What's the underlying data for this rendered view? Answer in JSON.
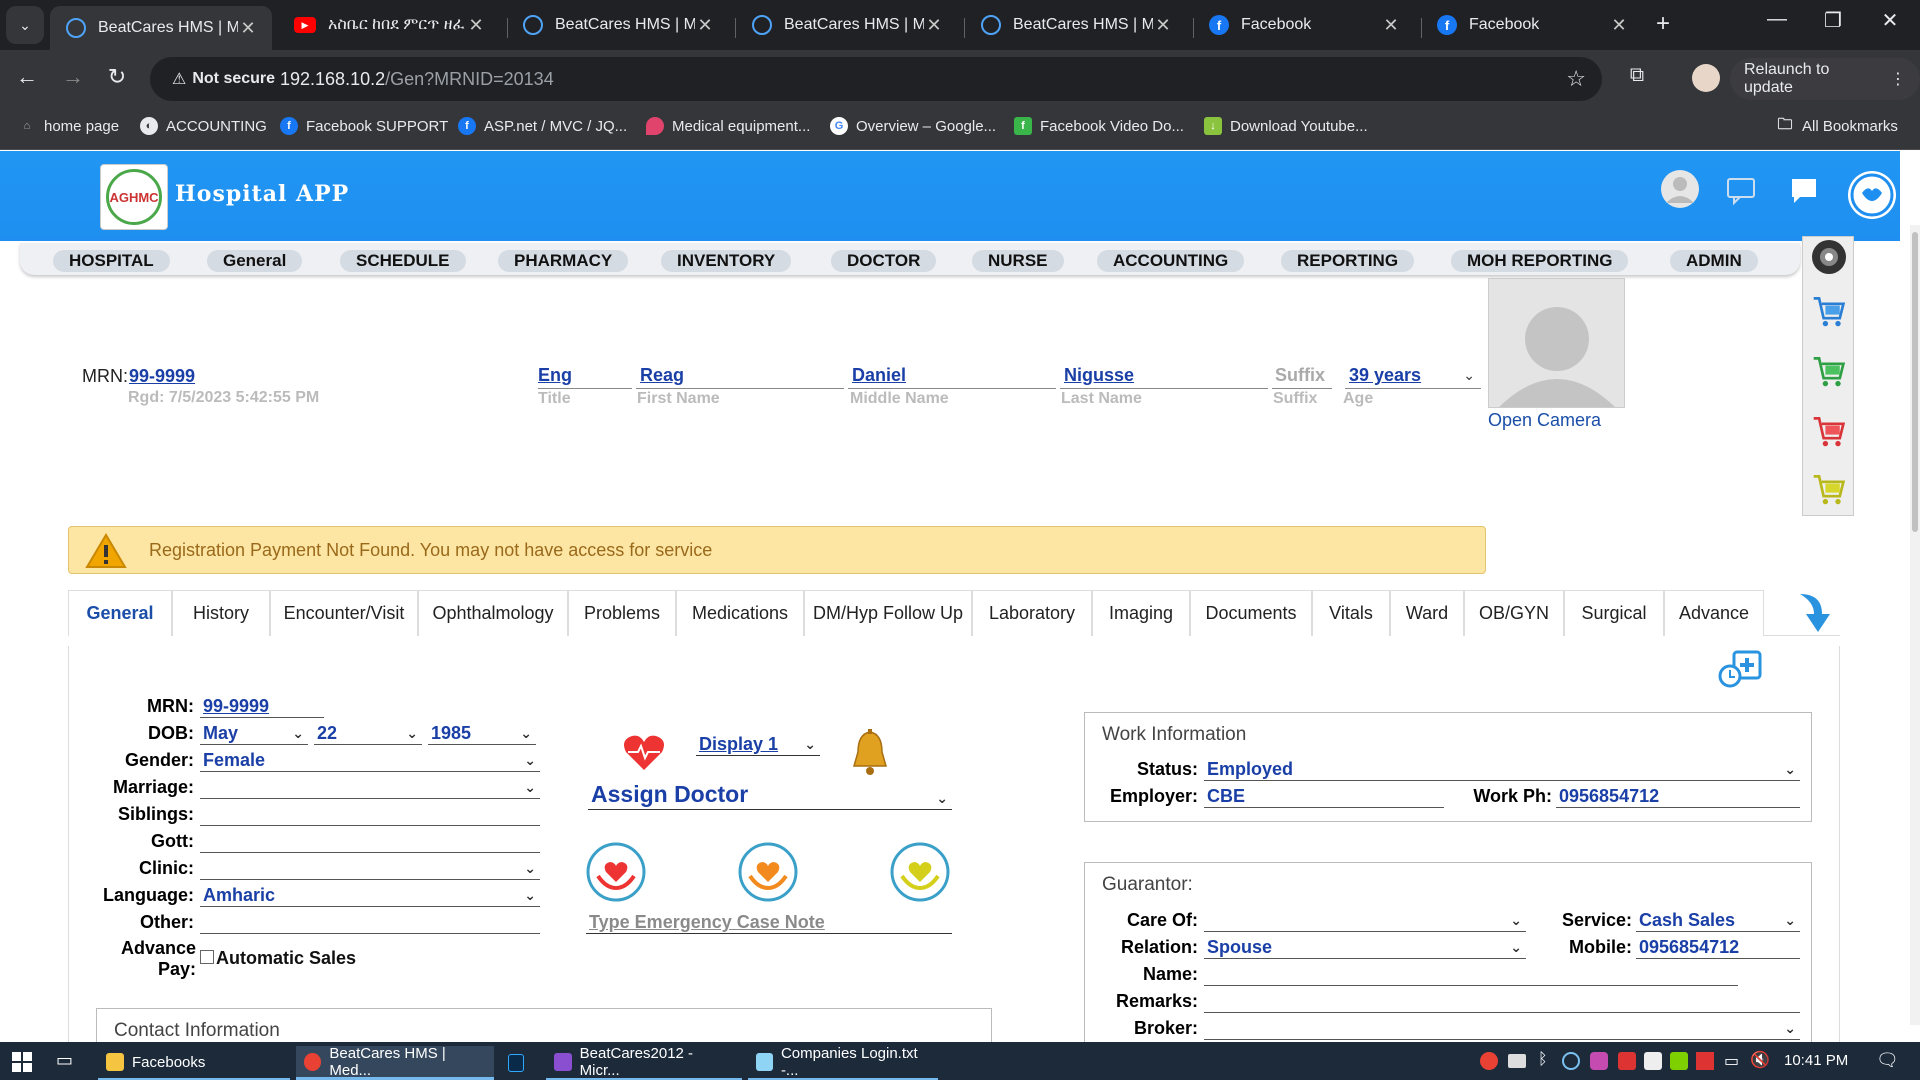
{
  "browser": {
    "tabs": [
      {
        "title": "BeatCares HMS | Me",
        "active": true
      },
      {
        "title": "አስቤር ከበደ ምርጥ ዘፈ",
        "active": false
      },
      {
        "title": "BeatCares HMS | Me",
        "active": false
      },
      {
        "title": "BeatCares HMS | Me",
        "active": false
      },
      {
        "title": "BeatCares HMS | Me",
        "active": false
      },
      {
        "title": "Facebook",
        "active": false
      },
      {
        "title": "Facebook",
        "active": false
      }
    ],
    "security_label": "Not secure",
    "url_host": "192.168.10.2",
    "url_path": "/Gen?MRNID=20134",
    "relaunch_label": "Relaunch to update",
    "bookmarks": [
      "home page",
      "ACCOUNTING",
      "Facebook SUPPORT",
      "ASP.net / MVC / JQ...",
      "Medical equipment...",
      "Overview – Google...",
      "Facebook Video Do...",
      "Download Youtube..."
    ],
    "all_bookmarks": "All Bookmarks"
  },
  "app": {
    "title": "Hospital APP",
    "logo_text": "AGHMC",
    "nav": [
      "HOSPITAL",
      "General",
      "SCHEDULE",
      "PHARMACY",
      "INVENTORY",
      "DOCTOR",
      "NURSE",
      "ACCOUNTING",
      "REPORTING",
      "MOH REPORTING",
      "ADMIN"
    ]
  },
  "patient": {
    "mrn_label": "MRN:",
    "mrn": "99-9999",
    "registered": "Rgd: 7/5/2023 5:42:55 PM",
    "title": "Eng",
    "title_label": "Title",
    "first_name": "Reag",
    "first_name_label": "First Name",
    "middle_name": "Daniel",
    "middle_name_label": "Middle Name",
    "last_name": "Nigusse",
    "last_name_label": "Last Name",
    "suffix": "Suffix",
    "suffix_label": "Suffix",
    "age": "39 years",
    "age_label": "Age",
    "open_camera": "Open Camera"
  },
  "alert": "Registration Payment Not Found. You may not have access for service",
  "tabs": [
    "General",
    "History",
    "Encounter/Visit",
    "Ophthalmology",
    "Problems",
    "Medications",
    "DM/Hyp Follow Up",
    "Laboratory",
    "Imaging",
    "Documents",
    "Vitals",
    "Ward",
    "OB/GYN",
    "Surgical",
    "Advance"
  ],
  "general": {
    "labels": {
      "mrn": "MRN:",
      "dob": "DOB:",
      "gender": "Gender:",
      "marriage": "Marriage:",
      "siblings": "Siblings:",
      "gott": "Gott:",
      "clinic": "Clinic:",
      "language": "Language:",
      "other": "Other:",
      "advance_pay": "Advance Pay:"
    },
    "mrn": "99-9999",
    "dob_month": "May",
    "dob_day": "22",
    "dob_year": "1985",
    "gender": "Female",
    "language": "Amharic",
    "automatic_sales": "Automatic Sales",
    "display": "Display 1",
    "assign_doctor": "Assign Doctor",
    "emergency_note": "Type Emergency Case Note",
    "contact_title": "Contact Information"
  },
  "work": {
    "title": "Work Information",
    "status_label": "Status:",
    "status": "Employed",
    "employer_label": "Employer:",
    "employer": "CBE",
    "workph_label": "Work Ph:",
    "workph": "0956854712"
  },
  "guarantor": {
    "title": "Guarantor:",
    "careof_label": "Care Of:",
    "service_label": "Service:",
    "service": "Cash Sales",
    "relation_label": "Relation:",
    "relation": "Spouse",
    "mobile_label": "Mobile:",
    "mobile": "0956854712",
    "name_label": "Name:",
    "remarks_label": "Remarks:",
    "broker_label": "Broker:"
  },
  "taskbar": {
    "items": [
      "Facebooks",
      "BeatCares HMS | Med...",
      "BeatCares2012 - Micr...",
      "Companies Login.txt -..."
    ],
    "clock": "10:41 PM"
  }
}
